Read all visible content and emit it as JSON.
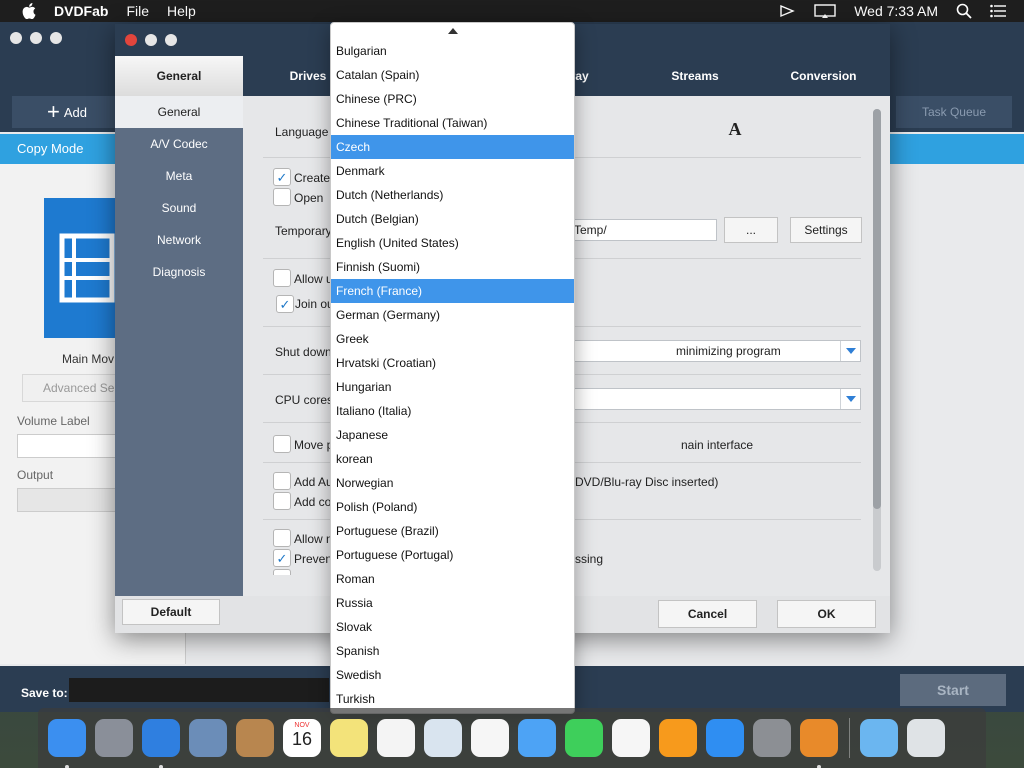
{
  "menubar": {
    "apple": "apple-icon",
    "app_name": "DVDFab",
    "menus": [
      "File",
      "Help"
    ],
    "clock": "Wed 7:33 AM"
  },
  "main": {
    "add_label": "Add",
    "task_queue_label": "Task Queue",
    "copy_mode": "Copy Mode",
    "main_movie": "Main Mov",
    "advanced_settings": "Advanced Se",
    "volume_label": "Volume Label",
    "output_label": "Output",
    "save_to": "Save to:",
    "start_label": "Start"
  },
  "dialog": {
    "tabs": [
      "General",
      "Drives",
      "Blu-ray",
      "Streams",
      "Conversion"
    ],
    "sidebar": [
      "General",
      "A/V Codec",
      "Meta",
      "Sound",
      "Network",
      "Diagnosis"
    ],
    "content": {
      "language_label": "Language",
      "create_label": "Create",
      "open_label": "Open",
      "temporary_label": "Temporary",
      "temp_value": "Temp/",
      "browse_label": "...",
      "settings_label": "Settings",
      "allow_u_label": "Allow u",
      "join_label": "Join ou",
      "shutdown_label": "Shut down",
      "shutdown_value": "minimizing program",
      "cpu_label": "CPU cores",
      "move_label": "Move p",
      "move_tail": "nain interface",
      "add_auto_label": "Add Au",
      "add_auto_tail": "DVD/Blu-ray Disc inserted)",
      "add_co_label": "Add co",
      "allow_n_label": "Allow n",
      "prevent_label": "Preven",
      "prevent_tail": "ssing"
    },
    "default_label": "Default",
    "cancel_label": "Cancel",
    "ok_label": "OK"
  },
  "dropdown": {
    "selected_index": 10,
    "hover_index": 4,
    "items": [
      "Bulgarian",
      "Catalan (Spain)",
      "Chinese (PRC)",
      "Chinese Traditional (Taiwan)",
      "Czech",
      "Denmark",
      "Dutch (Netherlands)",
      "Dutch (Belgian)",
      "English (United States)",
      "Finnish (Suomi)",
      "French (France)",
      "German (Germany)",
      "Greek",
      "Hrvatski (Croatian)",
      "Hungarian",
      "Italiano (Italia)",
      "Japanese",
      "korean",
      "Norwegian",
      "Polish (Poland)",
      "Portuguese (Brazil)",
      "Portuguese (Portugal)",
      "Roman",
      "Russia",
      "Slovak",
      "Spanish",
      "Swedish",
      "Turkish"
    ]
  },
  "dock": {
    "calendar_month": "NOV",
    "calendar_day": "16",
    "apps": [
      {
        "name": "finder-icon",
        "color": "#3b8ff0",
        "running": true
      },
      {
        "name": "launchpad-icon",
        "color": "#8a8f99",
        "running": false
      },
      {
        "name": "safari-icon",
        "color": "#2f7fe0",
        "running": true
      },
      {
        "name": "mail-stamp-icon",
        "color": "#6b8db8",
        "running": false
      },
      {
        "name": "contacts-icon",
        "color": "#b8864f",
        "running": false
      },
      {
        "name": "calendar-icon",
        "color": "#ffffff",
        "running": false
      },
      {
        "name": "notes-icon",
        "color": "#f3e37a",
        "running": false
      },
      {
        "name": "reminders-icon",
        "color": "#f4f4f4",
        "running": false
      },
      {
        "name": "preview-icon",
        "color": "#d9e4ef",
        "running": false
      },
      {
        "name": "photos-icon",
        "color": "#f6f6f6",
        "running": false
      },
      {
        "name": "messages-icon",
        "color": "#4da3f5",
        "running": false
      },
      {
        "name": "facetime-icon",
        "color": "#3ecf5b",
        "running": false
      },
      {
        "name": "music-icon",
        "color": "#f6f6f6",
        "running": false
      },
      {
        "name": "books-icon",
        "color": "#f79a1c",
        "running": false
      },
      {
        "name": "app-store-icon",
        "color": "#2f8ef2",
        "running": false
      },
      {
        "name": "system-preferences-icon",
        "color": "#8c8f94",
        "running": false
      },
      {
        "name": "dvdfab-icon",
        "color": "#e88a2a",
        "running": true
      }
    ],
    "trash": [
      {
        "name": "downloads-folder-icon",
        "color": "#6bb6f0"
      },
      {
        "name": "trash-icon",
        "color": "#dfe3e6"
      }
    ]
  }
}
